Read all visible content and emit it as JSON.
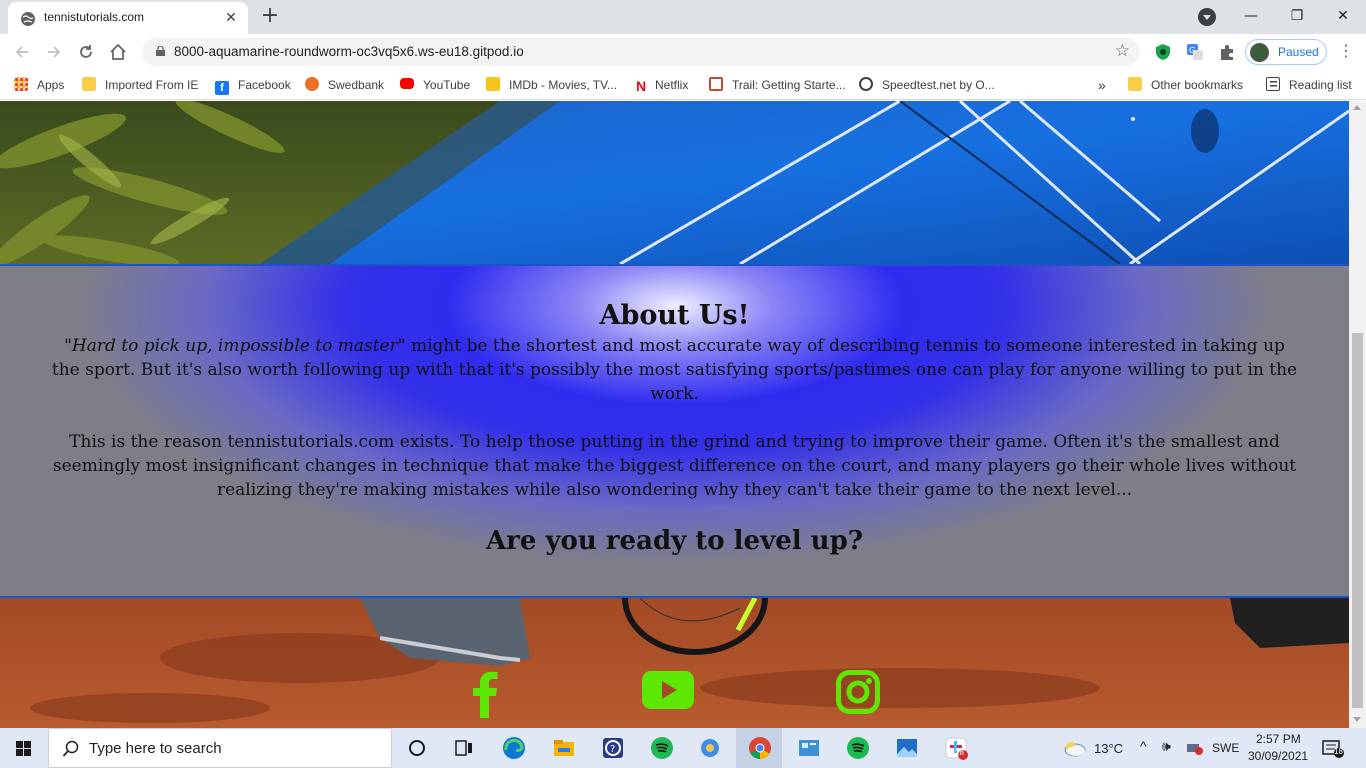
{
  "browser": {
    "tab_title": "tennistutorials.com",
    "tab_close": "✕",
    "new_tab": "+",
    "url": "8000-aquamarine-roundworm-oc3vq5x6.ws-eu18.gitpod.io",
    "profile_label": "Paused",
    "window_minimize": "—",
    "window_restore": "❐",
    "window_close": "✕",
    "bookmarks": [
      {
        "label": "Apps",
        "icon": "apps-grid-icon"
      },
      {
        "label": "Imported From IE",
        "icon": "folder-icon"
      },
      {
        "label": "Facebook",
        "icon": "facebook-icon"
      },
      {
        "label": "Swedbank",
        "icon": "swedbank-icon"
      },
      {
        "label": "YouTube",
        "icon": "youtube-icon"
      },
      {
        "label": "IMDb - Movies, TV...",
        "icon": "imdb-icon"
      },
      {
        "label": "Netflix",
        "icon": "netflix-icon"
      },
      {
        "label": "Trail: Getting Starte...",
        "icon": "trail-icon"
      },
      {
        "label": "Speedtest.net by O...",
        "icon": "speedtest-icon"
      }
    ],
    "bookmarks_overflow": "»",
    "other_bookmarks": "Other bookmarks",
    "reading_list": "Reading list"
  },
  "page": {
    "about_title": "About Us!",
    "about_quote": "\"Hard to pick up, impossible to master\"",
    "about_p1_rest": " might be the shortest and most accurate way of describing tennis to someone interested in taking up the sport. But it's also worth following up with that it's possibly the most satisfying sports/pastimes one can play for anyone willing to put in the work.",
    "about_p2": "This is the reason tennistutorials.com exists. To help those putting in the grind and trying to improve their game. Often it's the smallest and seemingly most insignificant changes in technique that make the biggest difference on the court, and many players go their whole lives without realizing they're making mistakes while also wondering why they can't take their game to the next level...",
    "cta": "Are you ready to level up?",
    "social": [
      "facebook-icon",
      "youtube-icon",
      "instagram-icon"
    ],
    "social_color": "#5ee605",
    "accent_border": "#1b53c9"
  },
  "taskbar": {
    "search_placeholder": "Type here to search",
    "weather": "13°C",
    "language": "SWE",
    "time": "2:57 PM",
    "date": "30/09/2021",
    "notifications": "18",
    "badge": "28"
  }
}
